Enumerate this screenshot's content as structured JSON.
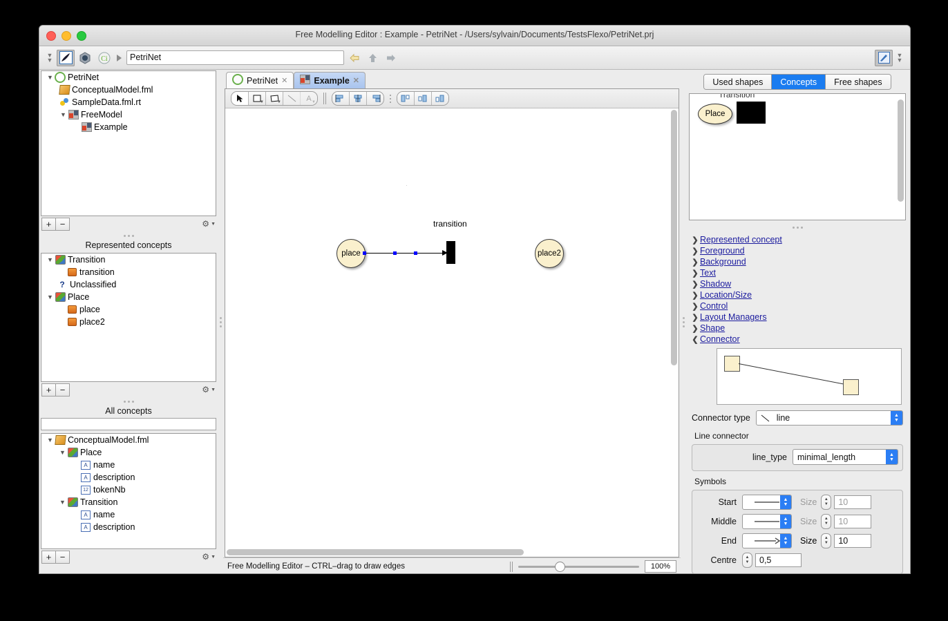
{
  "window": {
    "title": "Free Modelling Editor : Example - PetriNet - /Users/sylvain/Documents/TestsFlexo/PetriNet.prj"
  },
  "toolbar": {
    "address_value": "PetriNet",
    "icons": [
      "chevrons-down-icon",
      "feather-editor-icon",
      "model-icon",
      "concept-icon"
    ],
    "nav": [
      "back-arrow-icon",
      "up-arrow-icon",
      "forward-arrow-icon"
    ],
    "right_icons": [
      "edit-perspective-icon",
      "chevrons-down-icon"
    ]
  },
  "project_tree": {
    "items": [
      {
        "label": "PetriNet",
        "icon": "project-icon",
        "twisty": "down",
        "indent": 0
      },
      {
        "label": "ConceptualModel.fml",
        "icon": "fml-icon",
        "twisty": "",
        "indent": 1
      },
      {
        "label": "SampleData.fml.rt",
        "icon": "runtime-icon",
        "twisty": "",
        "indent": 1
      },
      {
        "label": "FreeModel",
        "icon": "free-model-icon",
        "twisty": "down",
        "indent": 1
      },
      {
        "label": "Example",
        "icon": "free-model-icon",
        "twisty": "",
        "indent": 2
      }
    ],
    "buttons": {
      "add": "+",
      "remove": "−",
      "gear": "gear-icon"
    }
  },
  "represented_concepts": {
    "title": "Represented concepts",
    "items": [
      {
        "label": "Transition",
        "icon": "concept-icon",
        "twisty": "down",
        "indent": 0
      },
      {
        "label": "transition",
        "icon": "instance-icon",
        "twisty": "",
        "indent": 1
      },
      {
        "label": "Unclassified",
        "icon": "question-icon",
        "twisty": "",
        "indent": 0
      },
      {
        "label": "Place",
        "icon": "concept-icon",
        "twisty": "down",
        "indent": 0
      },
      {
        "label": "place",
        "icon": "instance-icon",
        "twisty": "",
        "indent": 1
      },
      {
        "label": "place2",
        "icon": "instance-icon",
        "twisty": "",
        "indent": 1
      }
    ],
    "buttons": {
      "add": "+",
      "remove": "−",
      "gear": "gear-icon"
    }
  },
  "all_concepts": {
    "title": "All concepts",
    "filter_value": "",
    "items": [
      {
        "label": "ConceptualModel.fml",
        "icon": "fml-icon",
        "twisty": "down",
        "indent": 0
      },
      {
        "label": "Place",
        "icon": "concept-icon",
        "twisty": "down",
        "indent": 1
      },
      {
        "label": "name",
        "icon": "string-attr-icon",
        "twisty": "",
        "indent": 2
      },
      {
        "label": "description",
        "icon": "string-attr-icon",
        "twisty": "",
        "indent": 2
      },
      {
        "label": "tokenNb",
        "icon": "number-attr-icon",
        "twisty": "",
        "indent": 2
      },
      {
        "label": "Transition",
        "icon": "concept-icon",
        "twisty": "down",
        "indent": 1
      },
      {
        "label": "name",
        "icon": "string-attr-icon",
        "twisty": "",
        "indent": 2
      },
      {
        "label": "description",
        "icon": "string-attr-icon",
        "twisty": "",
        "indent": 2
      }
    ],
    "buttons": {
      "add": "+",
      "remove": "−",
      "gear": "gear-icon"
    }
  },
  "editor": {
    "tabs": [
      {
        "label": "PetriNet",
        "icon": "project-icon",
        "active": false
      },
      {
        "label": "Example",
        "icon": "free-model-icon",
        "active": true
      }
    ],
    "tools": [
      "select-arrow-icon",
      "rectangle-icon",
      "polygon-icon",
      "line-icon",
      "text-icon"
    ],
    "align_tools": [
      "align-left-icon",
      "align-center-icon",
      "align-right-icon"
    ],
    "distribute_tools": [
      "distribute-top-icon",
      "distribute-middle-icon",
      "distribute-bottom-icon"
    ],
    "diagram": {
      "place": "place",
      "place2": "place2",
      "transition": "transition"
    }
  },
  "status": {
    "text": "Free Modelling Editor – CTRL–drag to draw edges",
    "zoom": "100%"
  },
  "inspector": {
    "tabs": [
      {
        "label": "Used shapes",
        "active": false
      },
      {
        "label": "Concepts",
        "active": true
      },
      {
        "label": "Free shapes",
        "active": false
      }
    ],
    "palette": {
      "cut_label": "Transition",
      "place_label": "Place",
      "transition_label": ""
    },
    "sections": [
      {
        "label": "Represented concept",
        "expanded": false
      },
      {
        "label": "Foreground",
        "expanded": false
      },
      {
        "label": "Background",
        "expanded": false
      },
      {
        "label": "Text",
        "expanded": false
      },
      {
        "label": "Shadow",
        "expanded": false
      },
      {
        "label": "Location/Size",
        "expanded": false
      },
      {
        "label": "Control",
        "expanded": false
      },
      {
        "label": "Layout Managers",
        "expanded": false
      },
      {
        "label": "Shape",
        "expanded": false
      },
      {
        "label": "Connector",
        "expanded": true
      }
    ],
    "connector": {
      "type_label": "Connector type",
      "type_value": "line",
      "line_connector_label": "Line connector",
      "line_type_label": "line_type",
      "line_type_value": "minimal_length"
    },
    "symbols": {
      "title": "Symbols",
      "rows": [
        {
          "label": "Start",
          "symbol": "plain-line-icon",
          "size_label": "Size",
          "size_value": "10",
          "enabled": false
        },
        {
          "label": "Middle",
          "symbol": "plain-line-icon",
          "size_label": "Size",
          "size_value": "10",
          "enabled": false
        },
        {
          "label": "End",
          "symbol": "arrow-line-icon",
          "size_label": "Size",
          "size_value": "10",
          "enabled": true
        }
      ],
      "centre_label": "Centre",
      "centre_value": "0,5"
    }
  },
  "colors": {
    "accent": "#1a7cf0",
    "link": "#1b1b9e",
    "node_fill": "#faf0cd",
    "handle": "#0000ff"
  }
}
